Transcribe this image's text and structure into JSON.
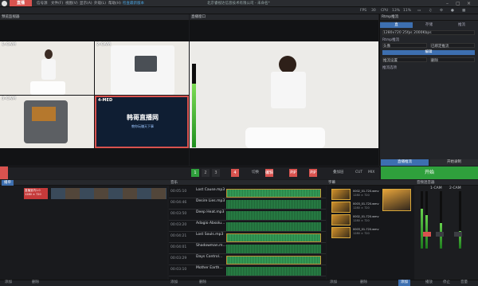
{
  "app": {
    "brand": "直播",
    "title": "北京睿视达信息技术有限公司 - 未命名*"
  },
  "menu": [
    "信号源",
    "文件(F)",
    "视图(V)",
    "显示(A)",
    "外观(L)",
    "帮助(H)",
    "检查最新版本"
  ],
  "toolbar": {
    "fps": "FPS",
    "fps_val": "30",
    "cpu": "CPU",
    "cpu_val": "13%",
    "cpu2": "11%"
  },
  "preview": {
    "title": "预览监视器",
    "cams": [
      "1-CAM",
      "2-CAM",
      "3-CAM",
      "4-MED"
    ],
    "overlay_title": "韩哥直播网",
    "overlay_sub": "教你玩赚天下事"
  },
  "program": {
    "title": "直播窗口"
  },
  "side": {
    "title": "Rtmp推流",
    "tabs": [
      "直",
      "存储",
      "推流"
    ],
    "field1": "1280x720  25fps  2000Kbps",
    "section": "Rtmp推流",
    "f2": "头像",
    "f3": "已绑定推流",
    "btn1": "编辑",
    "f4": "推流设置",
    "f5": "删除",
    "section2": "推流选项"
  },
  "controls": {
    "nums": [
      "1",
      "2",
      "3",
      "4"
    ],
    "labels": [
      "切换",
      "编辑",
      "PIP",
      "PIP"
    ],
    "right": [
      "叠加层",
      "CUT",
      "MIX"
    ],
    "start": "开始",
    "livebtn": "直播推流",
    "record": "开始录制"
  },
  "lower": {
    "timeline_title": "播单",
    "music_title": "音乐",
    "clip_title": "字幕",
    "mixer_title": "音频混音器",
    "mixer_ch": [
      "1-CAM",
      "2-CAM"
    ]
  },
  "music": [
    {
      "time": "00:05:10",
      "name": "Lost Cause.mp3"
    },
    {
      "time": "00:04:46",
      "name": "Desire Lies.mp3"
    },
    {
      "time": "00:03:50",
      "name": "Deep Heat.mp3"
    },
    {
      "time": "00:03:20",
      "name": "Adagio Absolu..."
    },
    {
      "time": "00:04:21",
      "name": "Lost Souls.mp3"
    },
    {
      "time": "00:04:01",
      "name": "Shadowman.m..."
    },
    {
      "time": "00:03:29",
      "name": "Days Control..."
    },
    {
      "time": "00:03:10",
      "name": "Mother Earth..."
    }
  ],
  "clips": [
    {
      "name": "0002_01-720.wmv",
      "sub": "1280 × 720"
    },
    {
      "name": "0003_01-720.wmv",
      "sub": "1280 × 720"
    },
    {
      "name": "0002_01-720.wmv",
      "sub": "1280 × 720"
    },
    {
      "name": "0003_01-720.wmv",
      "sub": "1280 × 720"
    }
  ],
  "timelineclip": {
    "name": "直播室内1.0",
    "size": "1280 × 720"
  },
  "bottom": [
    "添加",
    "删除",
    "添加",
    "删除",
    "添加",
    "删除",
    "添加",
    "播放",
    "停止",
    "音量"
  ],
  "colors": {
    "accent": "#d9534f",
    "green": "#2fa03c",
    "orange": "#d8a73a"
  }
}
